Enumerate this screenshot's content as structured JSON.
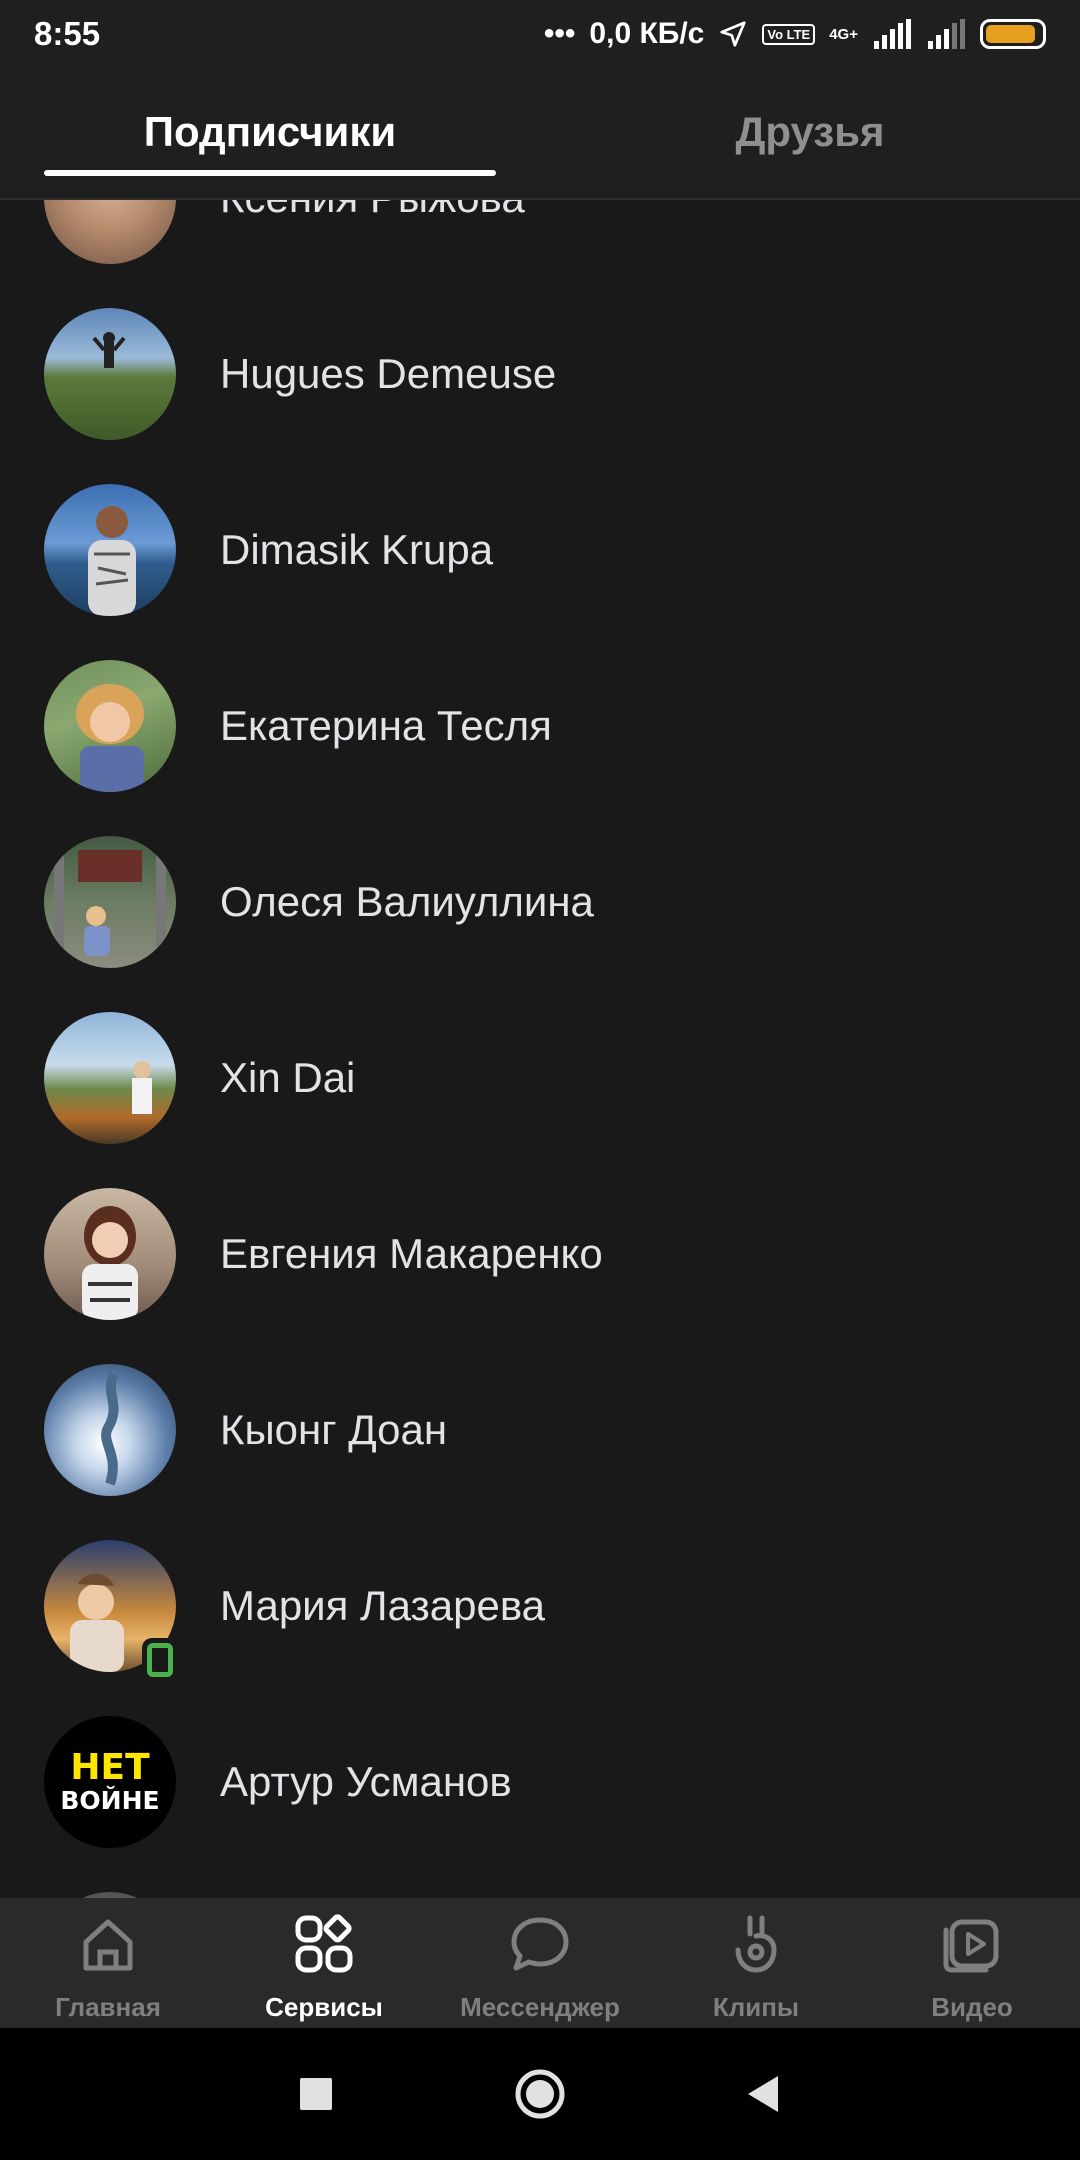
{
  "status_bar": {
    "time": "8:55",
    "network_speed": "0,0 КБ/с",
    "volte": "Vo LTE",
    "network_type": "4G+",
    "battery_level": 0.9
  },
  "tabs": [
    {
      "label": "Подписчики",
      "active": true
    },
    {
      "label": "Друзья",
      "active": false
    }
  ],
  "users": [
    {
      "name": "Ксения Рыжова",
      "online_mobile": false
    },
    {
      "name": "Hugues Demeuse",
      "online_mobile": false
    },
    {
      "name": "Dimasik Krupa",
      "online_mobile": false
    },
    {
      "name": "Екатерина Тесля",
      "online_mobile": false
    },
    {
      "name": "Олеся Валиуллина",
      "online_mobile": false
    },
    {
      "name": "Xin Dai",
      "online_mobile": false
    },
    {
      "name": "Евгения Макаренко",
      "online_mobile": false
    },
    {
      "name": "Кыонг Доан",
      "online_mobile": false
    },
    {
      "name": "Мария Лазарева",
      "online_mobile": true
    },
    {
      "name": "Артур Усманов",
      "online_mobile": false,
      "avatar_text": [
        "НЕТ",
        "ВОЙНЕ"
      ]
    }
  ],
  "bottom_nav": [
    {
      "label": "Главная",
      "icon": "home-icon",
      "active": false
    },
    {
      "label": "Сервисы",
      "icon": "services-icon",
      "active": true
    },
    {
      "label": "Мессенджер",
      "icon": "messenger-icon",
      "active": false
    },
    {
      "label": "Клипы",
      "icon": "clips-icon",
      "active": false
    },
    {
      "label": "Видео",
      "icon": "video-icon",
      "active": false
    }
  ],
  "system_nav": {
    "recents_icon": "recents-icon",
    "home_icon": "system-home-icon",
    "back_icon": "back-icon"
  },
  "colors": {
    "background": "#191919",
    "online": "#4bb34b",
    "battery": "#e8a021",
    "nav_bar": "#2a2a2a"
  }
}
